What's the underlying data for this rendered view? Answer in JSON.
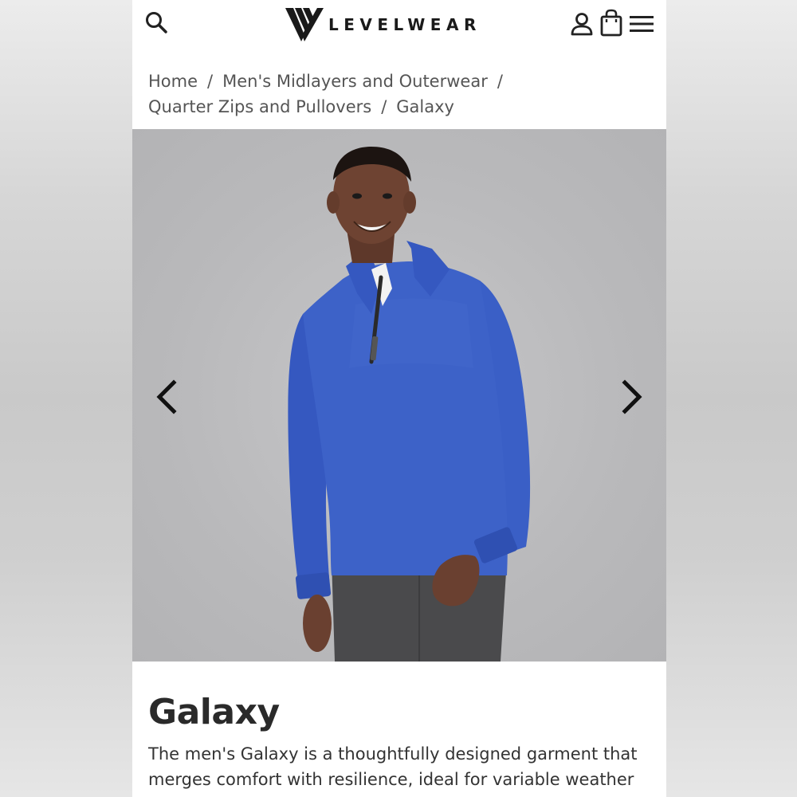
{
  "header": {
    "brand": "LEVELWEAR",
    "icons": [
      "search-icon",
      "account-icon",
      "shopping-bag-icon",
      "hamburger-menu-icon"
    ]
  },
  "breadcrumb": {
    "items": [
      "Home",
      "Men's Midlayers and Outerwear",
      "Quarter Zips and Pullovers",
      "Galaxy"
    ],
    "separator": "/"
  },
  "gallery": {
    "image_alt": "Man wearing blue quarter-zip pullover",
    "prev_icon": "chevron-left-icon",
    "next_icon": "chevron-right-icon"
  },
  "product": {
    "title": "Galaxy",
    "description": "The men's Galaxy is a thoughtfully designed garment that merges comfort with resilience, ideal for variable weather"
  },
  "colors": {
    "sweater": "#3a5fc4",
    "pants": "#4a4a4c",
    "background": "#bcbcbe",
    "text": "#2a2a2a"
  }
}
